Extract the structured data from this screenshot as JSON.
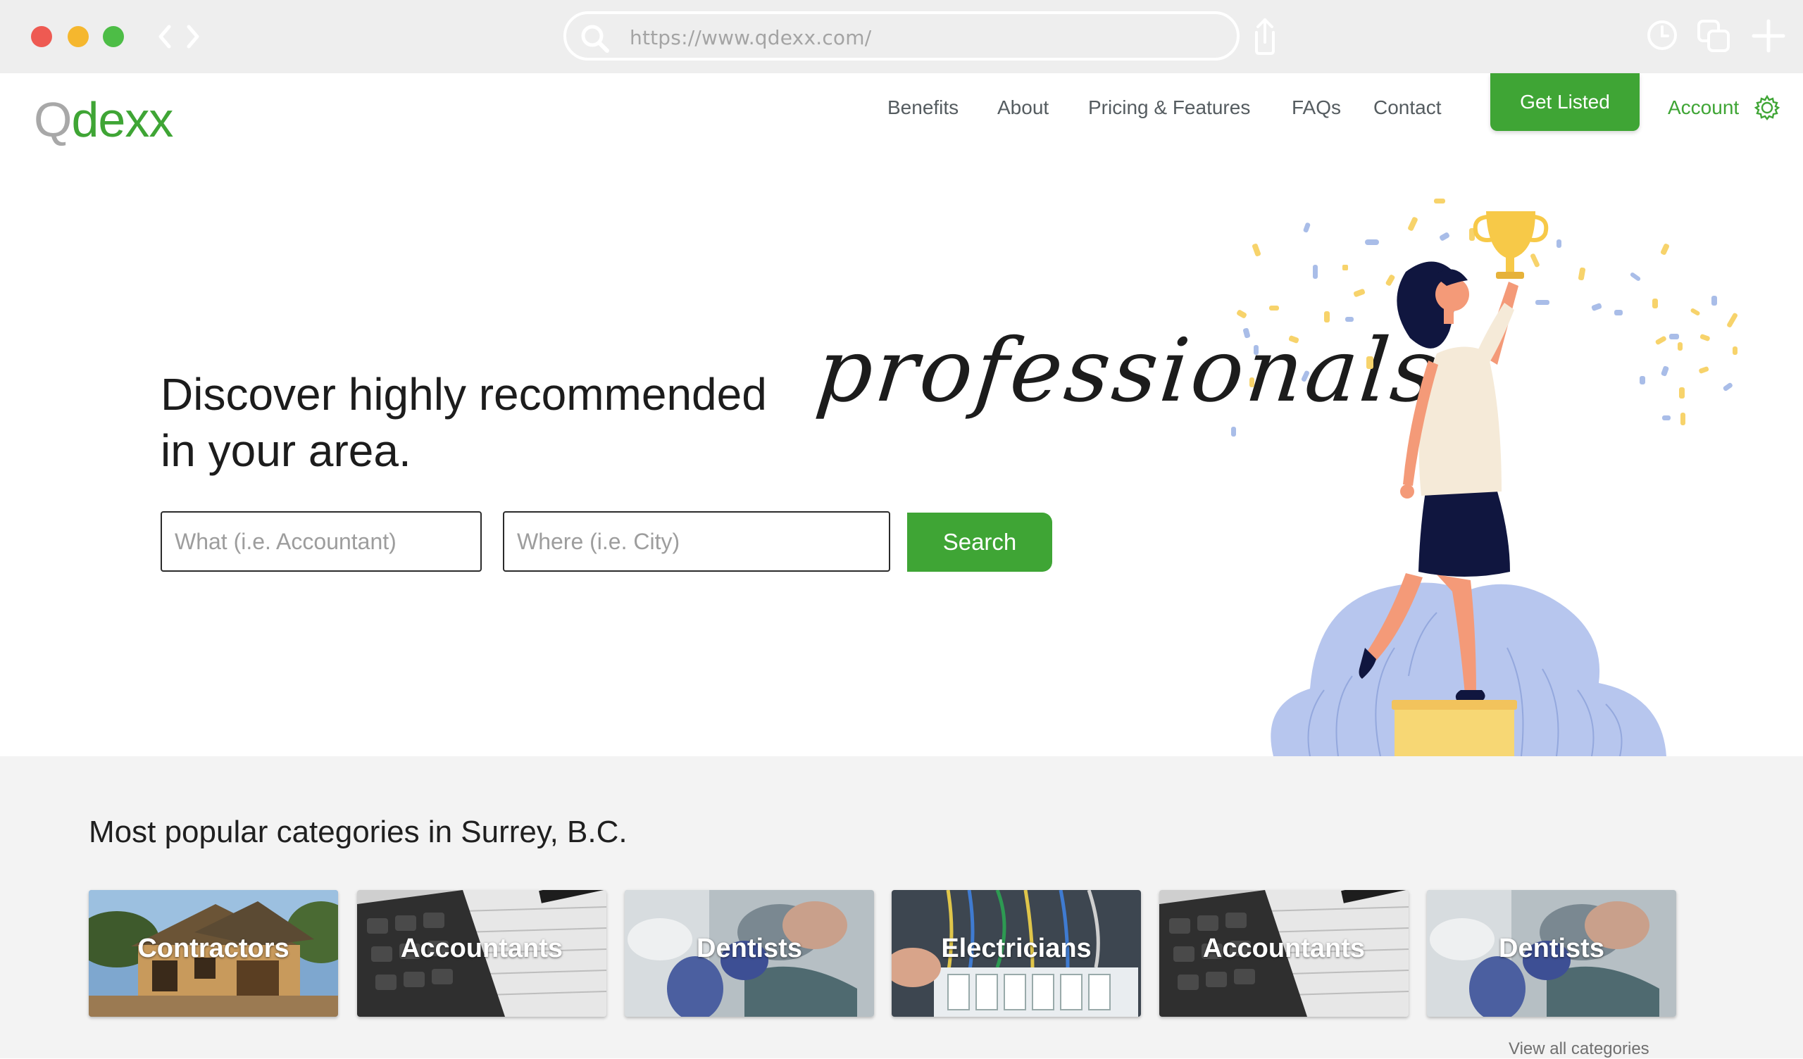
{
  "browser": {
    "url": "https://www.qdexx.com/"
  },
  "logo": {
    "part1": "Q",
    "part2": "d",
    "part3": "exx"
  },
  "nav": {
    "links": [
      "Benefits",
      "About",
      "Pricing & Features",
      "FAQs",
      "Contact"
    ],
    "cta": "Get Listed",
    "account": "Account"
  },
  "hero": {
    "line1": "Discover highly recommended",
    "script_word": "professionals",
    "line2": "in your area.",
    "what_placeholder": "What (i.e. Accountant)",
    "where_placeholder": "Where (i.e. City)",
    "search_label": "Search"
  },
  "categories": {
    "title": "Most popular categories in Surrey, B.C.",
    "items": [
      {
        "label": "Contractors",
        "image": "house-frame"
      },
      {
        "label": "Accountants",
        "image": "calculator"
      },
      {
        "label": "Dentists",
        "image": "dental-tools"
      },
      {
        "label": "Electricians",
        "image": "electrical-panel"
      },
      {
        "label": "Accountants",
        "image": "calculator"
      },
      {
        "label": "Dentists",
        "image": "dental-tools"
      }
    ],
    "view_all": "View all categories"
  },
  "colors": {
    "brand_green": "#3fa535",
    "logo_gray": "#a8a8a8",
    "chrome_bg": "#eeeeee",
    "section_bg": "#f3f3f3"
  }
}
